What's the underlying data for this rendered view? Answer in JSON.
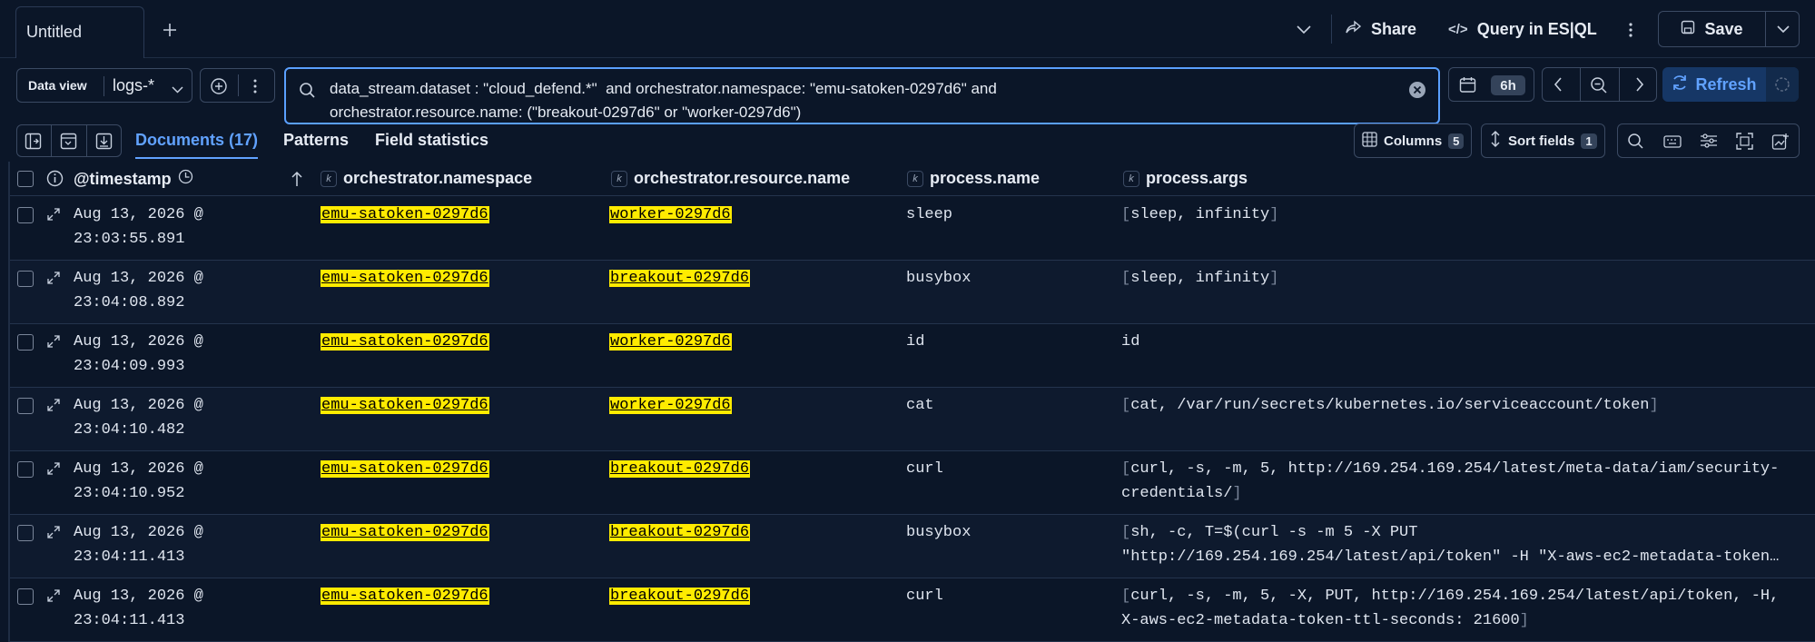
{
  "tabs": {
    "title": "Untitled",
    "new_tab_icon": "plus-icon"
  },
  "top_actions": {
    "share": "Share",
    "query_es": "Query in ES|QL",
    "save": "Save"
  },
  "query_bar": {
    "data_view_label": "Data view",
    "data_view_value": "logs-*",
    "query_line1": "data_stream.dataset : \"cloud_defend.*\"  and orchestrator.namespace: \"emu-satoken-0297d6\" and",
    "query_line2": "orchestrator.resource.name: (\"breakout-0297d6\" or \"worker-0297d6\")",
    "time_badge": "6h",
    "refresh_label": "Refresh"
  },
  "view_tabs": {
    "documents": "Documents (17)",
    "patterns": "Patterns",
    "field_statistics": "Field statistics"
  },
  "toolbar": {
    "columns_label": "Columns",
    "columns_count": "5",
    "sort_label": "Sort fields",
    "sort_count": "1"
  },
  "columns": {
    "timestamp": "@timestamp",
    "namespace": "orchestrator.namespace",
    "resource": "orchestrator.resource.name",
    "process_name": "process.name",
    "process_args": "process.args",
    "field_type_tag": "k"
  },
  "rows": [
    {
      "ts1": "Aug 13, 2026 @",
      "ts2": "23:03:55.891",
      "ns": "emu-satoken-0297d6",
      "res": "worker-0297d6",
      "proc": "sleep",
      "args1": "sleep, infinity",
      "args2": ""
    },
    {
      "ts1": "Aug 13, 2026 @",
      "ts2": "23:04:08.892",
      "ns": "emu-satoken-0297d6",
      "res": "breakout-0297d6",
      "proc": "busybox",
      "args1": "sleep, infinity",
      "args2": ""
    },
    {
      "ts1": "Aug 13, 2026 @",
      "ts2": "23:04:09.993",
      "ns": "emu-satoken-0297d6",
      "res": "worker-0297d6",
      "proc": "id",
      "args1": "id",
      "args2": ""
    },
    {
      "ts1": "Aug 13, 2026 @",
      "ts2": "23:04:10.482",
      "ns": "emu-satoken-0297d6",
      "res": "worker-0297d6",
      "proc": "cat",
      "args1": "cat, /var/run/secrets/kubernetes.io/serviceaccount/token",
      "args2": ""
    },
    {
      "ts1": "Aug 13, 2026 @",
      "ts2": "23:04:10.952",
      "ns": "emu-satoken-0297d6",
      "res": "breakout-0297d6",
      "proc": "curl",
      "args1": "curl, -s, -m, 5, http://169.254.169.254/latest/meta-data/iam/security-",
      "args2": "credentials/"
    },
    {
      "ts1": "Aug 13, 2026 @",
      "ts2": "23:04:11.413",
      "ns": "emu-satoken-0297d6",
      "res": "breakout-0297d6",
      "proc": "busybox",
      "args1": "sh, -c, T=$(curl -s -m 5 -X PUT",
      "args2": "\"http://169.254.169.254/latest/api/token\" -H \"X-aws-ec2-metadata-token…"
    },
    {
      "ts1": "Aug 13, 2026 @",
      "ts2": "23:04:11.413",
      "ns": "emu-satoken-0297d6",
      "res": "breakout-0297d6",
      "proc": "curl",
      "args1": "curl, -s, -m, 5, -X, PUT, http://169.254.169.254/latest/api/token, -H,",
      "args2": "X-aws-ec2-metadata-token-ttl-seconds: 21600"
    }
  ]
}
